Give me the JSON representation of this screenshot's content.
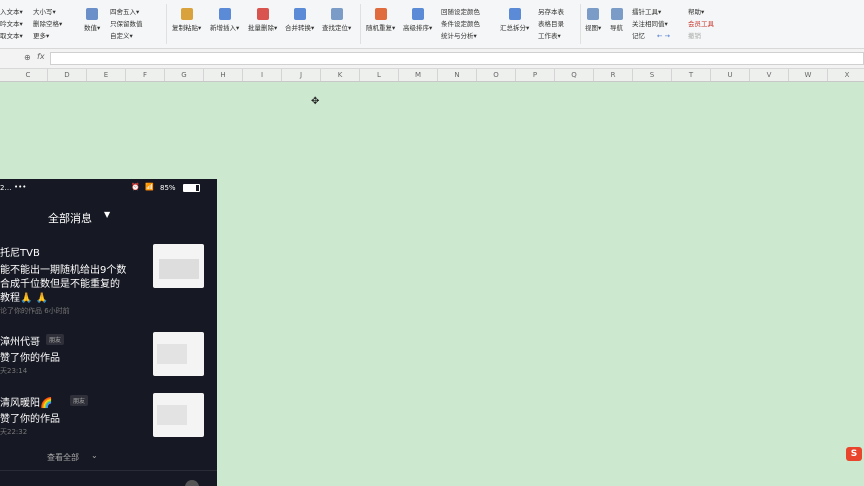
{
  "ribbon": {
    "col1": [
      "入文本▾",
      "吟文本▾",
      "取文本▾"
    ],
    "col2": [
      "大小写▾",
      "删除空格▾",
      "更多▾"
    ],
    "numbers_btn": "数值▾",
    "col3": [
      "四舍五入▾",
      "只保留数值",
      "自定义▾"
    ],
    "copy_paste": "复制粘贴▾",
    "insert": "新增插入▾",
    "batch_delete": "批量删除▾",
    "merge": "合并转换▾",
    "find": "查找定位▾",
    "random": "随机重复▾",
    "sort": "高级排序▾",
    "col4": [
      "回随设定颜色",
      "条件设定颜色",
      "统计与分析▾"
    ],
    "summary_split": "汇总拆分▾",
    "col5": [
      "另存本表",
      "表格目录",
      "工作表▾"
    ],
    "view": "视图▾",
    "nav": "导航",
    "col6": [
      "擂针工具▾",
      "关注相同值▾",
      "记忆"
    ],
    "col7": [
      "帮助▾",
      "会员工具",
      "撤销"
    ]
  },
  "formula": {
    "name_box_icon": "zoom-icon",
    "fx": "fx",
    "value": ""
  },
  "columns": [
    "C",
    "D",
    "E",
    "F",
    "G",
    "H",
    "I",
    "J",
    "K",
    "L",
    "M",
    "N",
    "O",
    "P",
    "Q",
    "R",
    "S",
    "T",
    "U",
    "V",
    "W",
    "X"
  ],
  "phone": {
    "status_time": "2…",
    "battery": "85%",
    "header": "全部消息",
    "items": [
      {
        "name": "托尼TVB",
        "line1": "能不能出一期随机给出9个数",
        "line2": "合成千位数但是不能重复的",
        "line3": "教程🙏 🙏",
        "meta": "论了你的作品  6小时前",
        "badge": ""
      },
      {
        "name": "漳州代哥",
        "line1": "赞了你的作品",
        "line2": "",
        "line3": "",
        "meta": "天23:14",
        "badge": "朋友"
      },
      {
        "name": "清风暖阳🌈",
        "line1": "赞了你的作品",
        "line2": "",
        "line3": "",
        "meta": "天22:32",
        "badge": "朋友"
      }
    ],
    "view_all": "查看全部"
  },
  "logo": "S"
}
